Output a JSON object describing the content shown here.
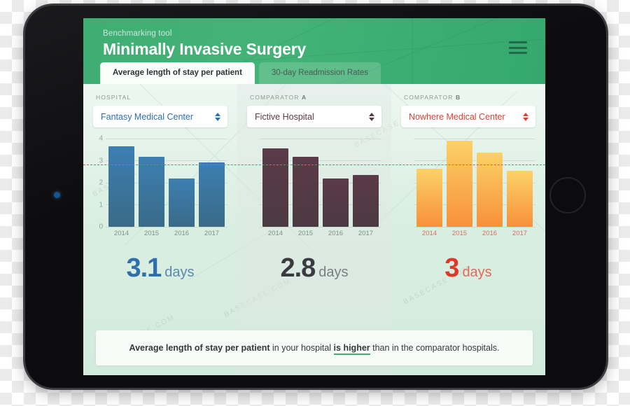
{
  "header": {
    "kicker": "Benchmarking tool",
    "title": "Minimally Invasive Surgery",
    "menu_icon": "hamburger-menu-icon",
    "accent": "#3fae73"
  },
  "tabs": [
    {
      "label": "Average length of stay per patient",
      "active": true
    },
    {
      "label": "30-day Readmission Rates",
      "active": false
    }
  ],
  "panels": [
    {
      "label": "HOSPITAL",
      "label_suffix": "",
      "selected": "Fantasy Medical Center",
      "color": "#2f6fad",
      "summary_value": "3.1",
      "summary_unit": "days"
    },
    {
      "label": "COMPARATOR",
      "label_suffix": "A",
      "selected": "Fictive Hospital",
      "color": "#5b3a48",
      "summary_value": "2.8",
      "summary_unit": "days"
    },
    {
      "label": "COMPARATOR",
      "label_suffix": "B",
      "selected": "Nowhere Medical Center",
      "color": "#de3f33",
      "summary_value": "3",
      "summary_unit": "days"
    }
  ],
  "footer": {
    "lead": "Average length of stay per patient",
    "mid": " in your hospital ",
    "highlight": "is higher",
    "tail": " than in the comparator hospitals."
  },
  "watermark_text": "BASECASE.COM",
  "chart_data": [
    {
      "type": "bar",
      "title": "Fantasy Medical Center",
      "categories": [
        "2014",
        "2015",
        "2016",
        "2017"
      ],
      "values": [
        4.0,
        3.5,
        2.4,
        3.2
      ],
      "ylabel": "",
      "xlabel": "",
      "ylim": [
        0,
        4.4
      ],
      "yticks": [
        0,
        1,
        2,
        3,
        4
      ],
      "grid": true,
      "bar_color": "#3c7fb1",
      "reference_line": 3.1,
      "reference_line_color": "#cf5d6b",
      "legend": "none"
    },
    {
      "type": "bar",
      "title": "Fictive Hospital",
      "categories": [
        "2014",
        "2015",
        "2016",
        "2017"
      ],
      "values": [
        3.9,
        3.5,
        2.4,
        2.6
      ],
      "ylabel": "",
      "xlabel": "",
      "ylim": [
        0,
        4.4
      ],
      "yticks": [
        0,
        1,
        2,
        3,
        4
      ],
      "grid": true,
      "bar_color": "#5b3a48",
      "reference_line": 3.1,
      "reference_line_color": "#cf5d6b",
      "legend": "none"
    },
    {
      "type": "bar",
      "title": "Nowhere Medical Center",
      "categories": [
        "2014",
        "2015",
        "2016",
        "2017"
      ],
      "values": [
        2.9,
        4.3,
        3.7,
        2.8
      ],
      "ylabel": "",
      "xlabel": "",
      "ylim": [
        0,
        4.4
      ],
      "yticks": [
        0,
        1,
        2,
        3,
        4
      ],
      "grid": true,
      "bar_color": "#f8a340",
      "reference_line": 3.1,
      "reference_line_color": "#cf5d6b",
      "legend": "none"
    }
  ]
}
